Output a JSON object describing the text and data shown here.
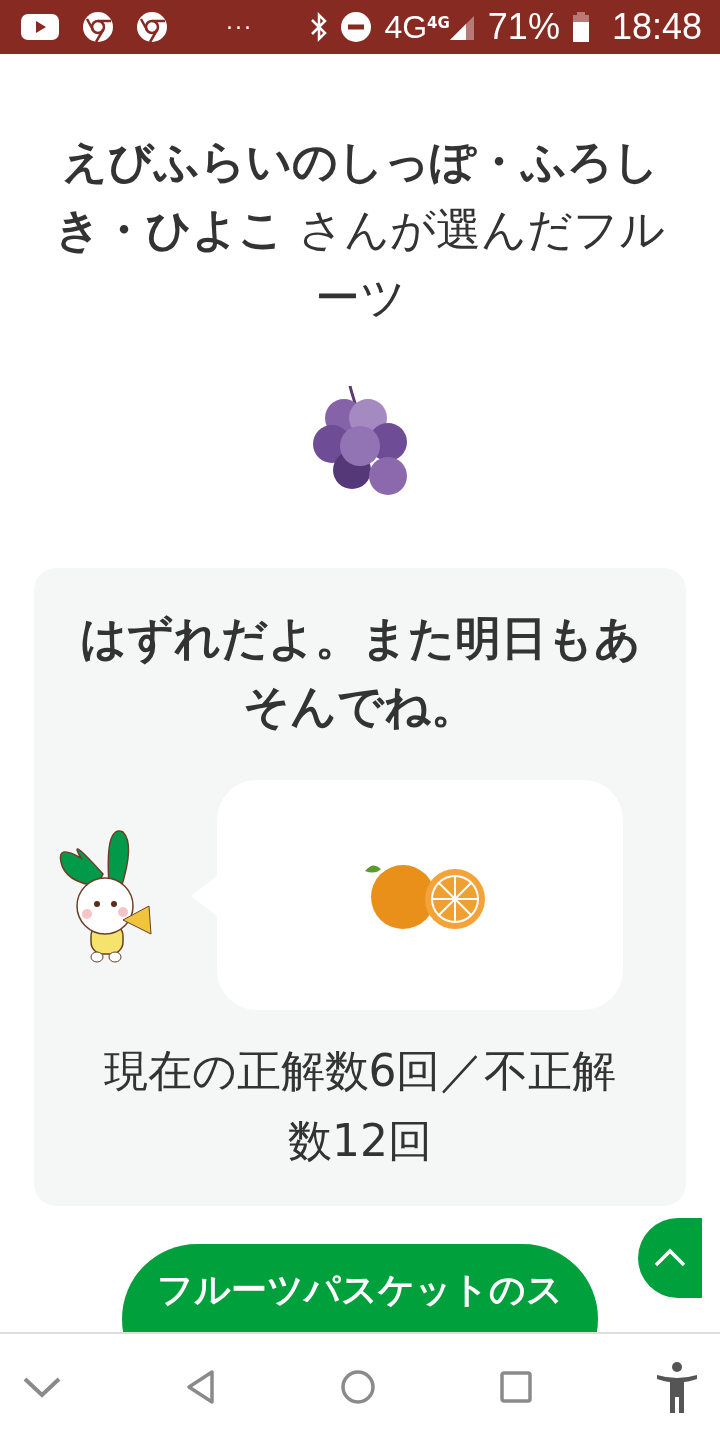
{
  "status_bar": {
    "more": "···",
    "network": "4G",
    "network_small": "4G",
    "battery": "71%",
    "time": "18:48"
  },
  "title": "**えびふらいのしっぽ・ふろしき・ひよこ** さんが選んだフルーツ",
  "result": {
    "message": "はずれだよ。また明日もあそんでね。",
    "score": "現在の正解数6回／不正解数12回"
  },
  "blog_button": {
    "label": "フルーツパスケットのス"
  }
}
